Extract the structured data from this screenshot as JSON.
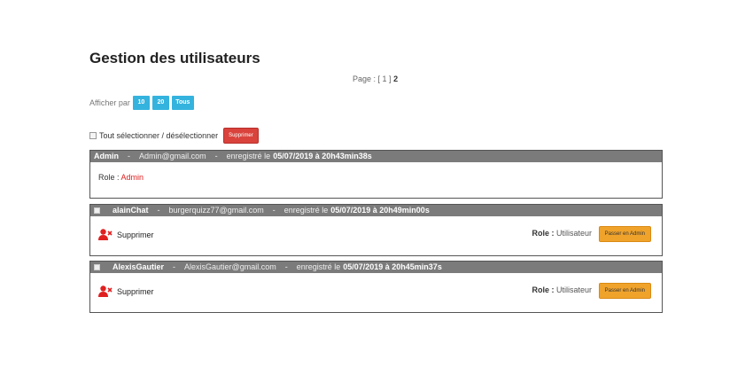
{
  "page": {
    "title": "Gestion des utilisateurs"
  },
  "pagination": {
    "prefix": "Page :",
    "first": "[ 1 ]",
    "current": "2"
  },
  "per_page": {
    "label": "Afficher par",
    "options": [
      "10",
      "20",
      "Tous"
    ]
  },
  "bulk": {
    "select_all_label": "Tout sélectionner / désélectionner",
    "delete_label": "Supprimer"
  },
  "labels": {
    "registered": "enregistré le",
    "role": "Role :",
    "delete_user": "Supprimer",
    "promote": "Passer en Admin"
  },
  "users": [
    {
      "name": "Admin",
      "email": "Admin@gmail.com",
      "date": "05/07/2019 à 20h43min38s",
      "role": "Admin"
    },
    {
      "name": "alainChat",
      "email": "burgerquizz77@gmail.com",
      "date": "05/07/2019 à 20h49min00s",
      "role": "Utilisateur"
    },
    {
      "name": "AlexisGautier",
      "email": "AlexisGautier@gmail.com",
      "date": "05/07/2019 à 20h45min37s",
      "role": "Utilisateur"
    }
  ],
  "colors": {
    "header_bar": "#7b7b7b",
    "accent_blue": "#34b3de",
    "danger_red": "#d9433c",
    "warning_orange": "#f0a32b",
    "admin_role": "#e02020"
  },
  "icons": {
    "delete_user": "user-remove-icon"
  }
}
